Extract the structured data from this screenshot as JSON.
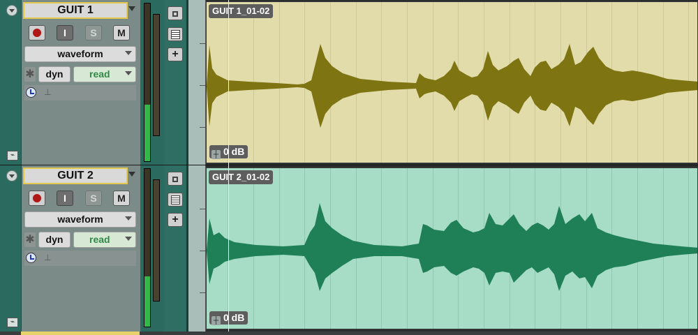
{
  "colors": {
    "track_panel": "#2f6f63",
    "track1_clip_bg": "#e1dcaa",
    "track1_wave": "#7f7412",
    "track2_clip_bg": "#a7dcc6",
    "track2_wave": "#1f8057",
    "name_border": "#e5c94f",
    "meter_green": "#34b84a",
    "read_text": "#2e8b47"
  },
  "tracks": [
    {
      "name": "GUIT 1",
      "rec_icon": "record-circle-icon",
      "input_label": "I",
      "solo_label": "S",
      "mute_label": "M",
      "view": "waveform",
      "automation_icon": "asterisk-icon",
      "dyn_label": "dyn",
      "automation_mode": "read",
      "timebase_icon": "clock-icon",
      "fader_icon": "fader-icon",
      "clip_name": "GUIT 1_01-02",
      "clip_gain": "0 dB",
      "meter_level": 0.36
    },
    {
      "name": "GUIT 2",
      "rec_icon": "record-circle-icon",
      "input_label": "I",
      "solo_label": "S",
      "mute_label": "M",
      "view": "waveform",
      "automation_icon": "asterisk-icon",
      "dyn_label": "dyn",
      "automation_mode": "read",
      "timebase_icon": "clock-icon",
      "fader_icon": "fader-icon",
      "clip_name": "GUIT 2_01-02",
      "clip_gain": "0 dB",
      "meter_level": 0.32
    }
  ],
  "side_buttons": {
    "add_label": "+"
  }
}
